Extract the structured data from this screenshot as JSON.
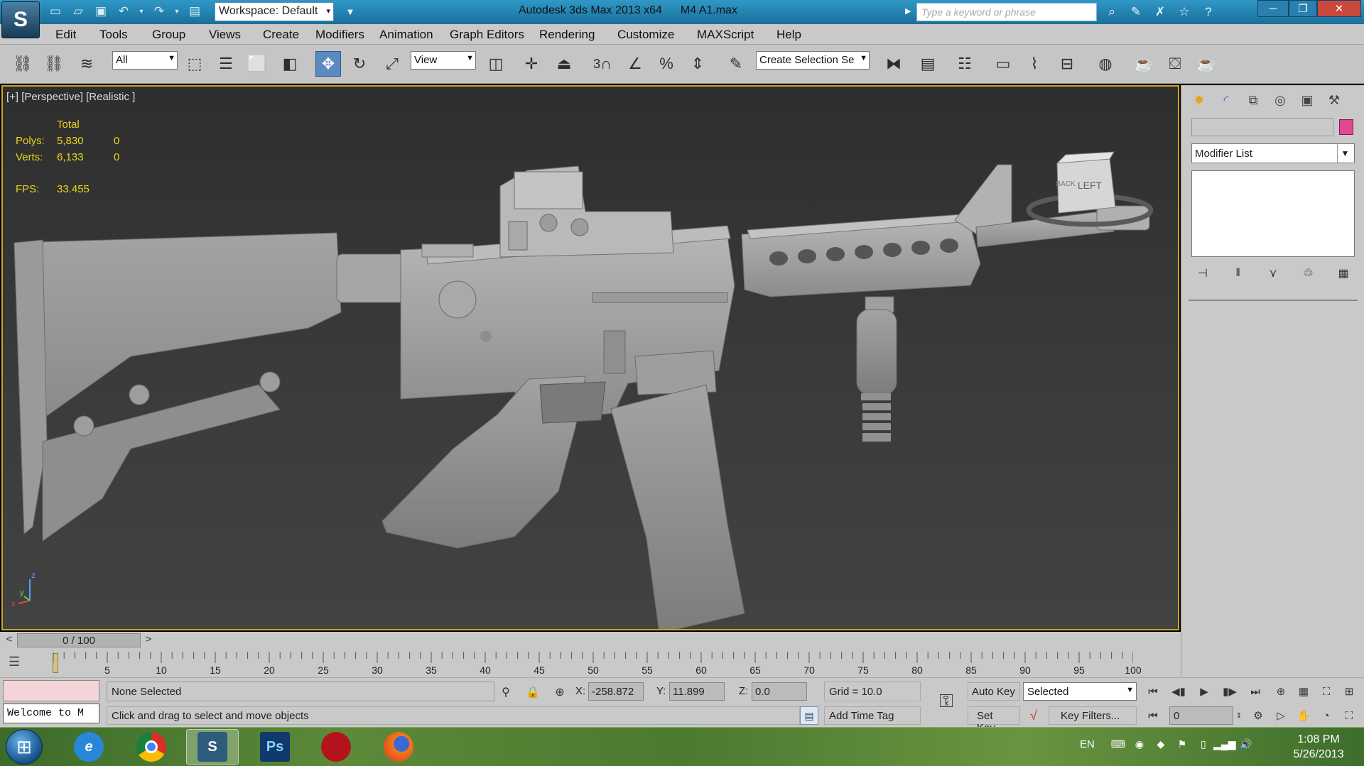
{
  "titlebar": {
    "workspace": "Workspace: Default",
    "app_title": "Autodesk 3ds Max  2013 x64",
    "file_name": "M4 A1.max",
    "search_placeholder": "Type a keyword or phrase"
  },
  "menu": [
    "Edit",
    "Tools",
    "Group",
    "Views",
    "Create",
    "Modifiers",
    "Animation",
    "Graph Editors",
    "Rendering",
    "Customize",
    "MAXScript",
    "Help"
  ],
  "toolbar": {
    "filter": "All",
    "ref_coord": "View",
    "named_selection": "Create Selection Se",
    "snap_angle_label": "3"
  },
  "viewport": {
    "label": "[+] [Perspective] [Realistic ]",
    "stats_header": "Total",
    "polys_label": "Polys:",
    "polys_total": "5,830",
    "polys_selected": "0",
    "verts_label": "Verts:",
    "verts_total": "6,133",
    "verts_selected": "0",
    "fps_label": "FPS:",
    "fps_value": "33.455",
    "viewcube_left": "LEFT",
    "viewcube_back": "BACK",
    "axis_z": "z",
    "axis_x": "x",
    "axis_y": "y"
  },
  "timeline": {
    "frame_display": "0 / 100",
    "prev": "<",
    "next": ">",
    "ticks": [
      "5",
      "10",
      "15",
      "20",
      "25",
      "30",
      "35",
      "40",
      "45",
      "50",
      "55",
      "60",
      "65",
      "70",
      "75",
      "80",
      "85",
      "90",
      "95",
      "100"
    ]
  },
  "command_panel": {
    "modifier_list": "Modifier List",
    "accent_color": "#e0488f"
  },
  "status": {
    "listener_text": "Welcome to M",
    "selection": "None Selected",
    "prompt": "Click and drag to select and move objects",
    "x_label": "X:",
    "x_value": "-258.872",
    "y_label": "Y:",
    "y_value": "11.899",
    "z_label": "Z:",
    "z_value": "0.0",
    "grid": "Grid = 10.0",
    "add_time_tag": "Add Time Tag",
    "auto_key": "Auto Key",
    "set_key": "Set Key",
    "key_mode": "Selected",
    "key_filters": "Key Filters...",
    "current_frame": "0"
  },
  "taskbar": {
    "apps": [
      "start-orb",
      "internet-explorer",
      "chrome",
      "3ds-max",
      "photoshop",
      "app-red",
      "firefox"
    ],
    "lang": "EN",
    "time": "1:08 PM",
    "date": "5/26/2013"
  }
}
